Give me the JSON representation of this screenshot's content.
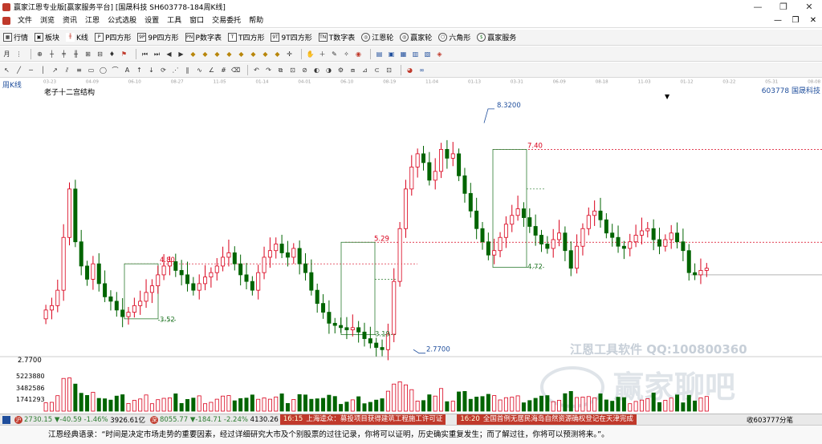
{
  "window": {
    "title": "赢家江恩专业版[赢家服务平台]  [国晟科技  SH603778-184周K线]",
    "controls": [
      "—",
      "❐",
      "✕"
    ]
  },
  "menu": {
    "items": [
      "文件",
      "浏览",
      "资讯",
      "江恩",
      "公式选股",
      "设置",
      "工具",
      "窗口",
      "交易委托",
      "帮助"
    ],
    "right": [
      "—",
      "❐",
      "✕"
    ]
  },
  "toolbar1": [
    {
      "label": "行情",
      "icon": "grid-icon"
    },
    {
      "label": "板块",
      "icon": "block-icon"
    },
    {
      "label": "K线",
      "icon": "kline-icon"
    },
    {
      "label": "P四方形",
      "icon": "P",
      "code": "P"
    },
    {
      "label": "9P四方形",
      "icon": "9P",
      "code": "9P"
    },
    {
      "label": "P数字表",
      "icon": "PN",
      "code": "PN"
    },
    {
      "label": "T四方形",
      "icon": "T",
      "code": "T"
    },
    {
      "label": "9T四方形",
      "icon": "9T",
      "code": "9T"
    },
    {
      "label": "T数字表",
      "icon": "TN",
      "code": "TN"
    },
    {
      "label": "江恩轮",
      "icon": "wheel",
      "code": "◎"
    },
    {
      "label": "赢家轮",
      "icon": "wheel",
      "code": "◎"
    },
    {
      "label": "六角形",
      "icon": "hex",
      "code": "⬡"
    },
    {
      "label": "赢家服务",
      "icon": "money",
      "code": "$"
    }
  ],
  "chart": {
    "period_label": "周K线",
    "indicator_title": "老子十二宫结构",
    "symbol_info": "603778  国晟科技",
    "dropdown_marker": "▼",
    "date_ticks": [
      "03-23",
      "04-09",
      "06-10",
      "08-27",
      "11-05",
      "01-14",
      "04-01",
      "06-10",
      "08-19",
      "11-04",
      "01-13",
      "03-31",
      "06-09",
      "08-18",
      "11-03",
      "01-12",
      "03-22",
      "05-31",
      "08-08"
    ],
    "price_annotations": [
      "8.3200",
      "7.40",
      "5.29",
      "4.80",
      "4.72",
      "3.52",
      "3.19",
      "2.7700"
    ],
    "axis_label_low": "2.7700",
    "volume_labels": [
      "5223880",
      "3482586",
      "1741293"
    ],
    "watermark": {
      "line1": "江恩工具软件  QQ:100800360",
      "brand": "赢家聊吧"
    }
  },
  "chart_data": {
    "type": "candlestick",
    "title": "老子十二宫结构",
    "symbol": "603778",
    "name": "国晟科技",
    "period": "周K线",
    "ylim": [
      2.6,
      8.5
    ],
    "levels": [
      8.32,
      7.4,
      5.29,
      4.8,
      4.72,
      3.52,
      3.19,
      2.77
    ],
    "close_series": [
      3.75,
      3.85,
      4.2,
      5.4,
      6.5,
      5.3,
      4.75,
      4.45,
      4.8,
      4.35,
      4.05,
      3.95,
      3.75,
      3.6,
      3.7,
      3.85,
      3.95,
      4.15,
      4.3,
      4.55,
      4.75,
      4.85,
      4.65,
      4.55,
      4.35,
      4.2,
      4.35,
      4.5,
      4.6,
      4.75,
      4.95,
      5.05,
      4.8,
      4.55,
      4.4,
      4.2,
      4.6,
      4.95,
      5.1,
      5.25,
      5.05,
      4.95,
      5.15,
      4.8,
      4.6,
      4.2,
      3.9,
      3.7,
      3.45,
      3.4,
      3.35,
      3.3,
      3.35,
      3.25,
      3.1,
      3.0,
      2.9,
      2.85,
      3.2,
      4.4,
      5.6,
      6.5,
      7.0,
      7.3,
      7.1,
      6.7,
      6.9,
      7.4,
      7.2,
      7.3,
      6.8,
      6.4,
      6.0,
      5.6,
      5.3,
      5.0,
      5.1,
      5.4,
      5.7,
      5.9,
      6.05,
      5.85,
      5.65,
      5.45,
      5.25,
      5.15,
      5.35,
      5.5,
      5.1,
      4.7,
      5.2,
      5.6,
      5.9,
      6.0,
      5.8,
      5.5,
      5.4,
      5.2,
      5.15,
      5.3,
      5.45,
      5.55,
      5.6,
      5.35,
      5.2,
      5.35,
      5.5,
      5.3,
      5.1,
      4.6,
      4.55,
      4.65,
      4.7
    ],
    "volume_max": 5223880
  },
  "status": {
    "sh_index": "2730.15",
    "sh_change": "▼-40.59",
    "sh_pct": "-1.46%",
    "sh_amount": "3926.61亿",
    "sz_index": "8055.77",
    "sz_change": "▼-184.71",
    "sz_pct": "-2.24%",
    "sz_amount": "4130.26",
    "news": [
      {
        "time": "16:15",
        "text": "上海逵众：募投项目获得建筑工程施工许可证"
      },
      {
        "time": "16:20",
        "text": "全国首例无居民海岛自然资源确权登记在天津完成"
      }
    ],
    "right_text": "收603777分笔"
  },
  "quote": {
    "text": "江恩经典语录：“时间是决定市场走势的重要因素，经过详细研究大市及个别股票的过往记录，你将可以证明，历史确实重复发生；而了解过往，你将可以预测将来。”。"
  }
}
